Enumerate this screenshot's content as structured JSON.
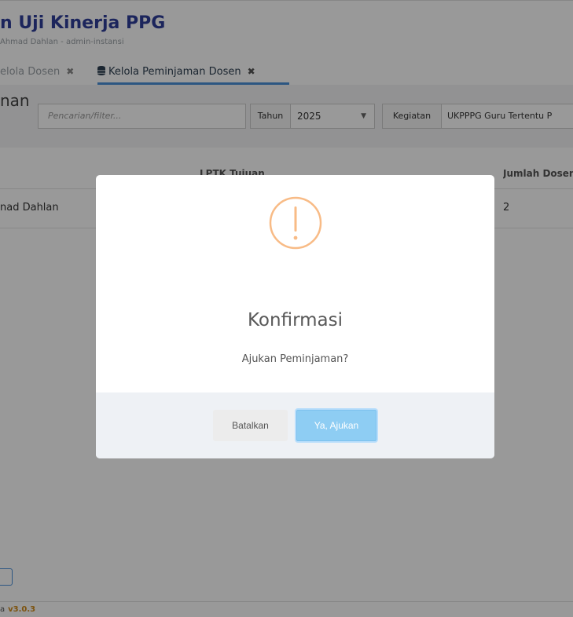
{
  "header": {
    "app_title": "n Uji Kinerja PPG",
    "app_subtitle": "Ahmad Dahlan - admin-instansi"
  },
  "tabs": [
    {
      "label": "elola Dosen",
      "close": "✖"
    },
    {
      "label": "Kelola Peminjaman Dosen",
      "close": "✖",
      "icon": "database-icon",
      "active": true
    }
  ],
  "filters": {
    "page_heading": "nan",
    "search_placeholder": "Pencarian/filter...",
    "tahun_label": "Tahun",
    "tahun_value": "2025",
    "kegiatan_label": "Kegiatan",
    "kegiatan_value": "UKPPPG Guru Tertentu P"
  },
  "table": {
    "headers": {
      "lptk": "LPTK Tujuan",
      "jumlah": "Jumlah Dosen"
    },
    "rows": [
      {
        "name": "nad Dahlan",
        "jumlah": "2"
      }
    ]
  },
  "footer": {
    "prefix": "a",
    "version": "v3.0.3"
  },
  "modal": {
    "icon": "warning-icon",
    "icon_color": "#f8bb86",
    "title": "Konfirmasi",
    "message": "Ajukan Peminjaman?",
    "cancel_label": "Batalkan",
    "confirm_label": "Ya, Ajukan",
    "confirm_color": "#8ecdf3"
  }
}
